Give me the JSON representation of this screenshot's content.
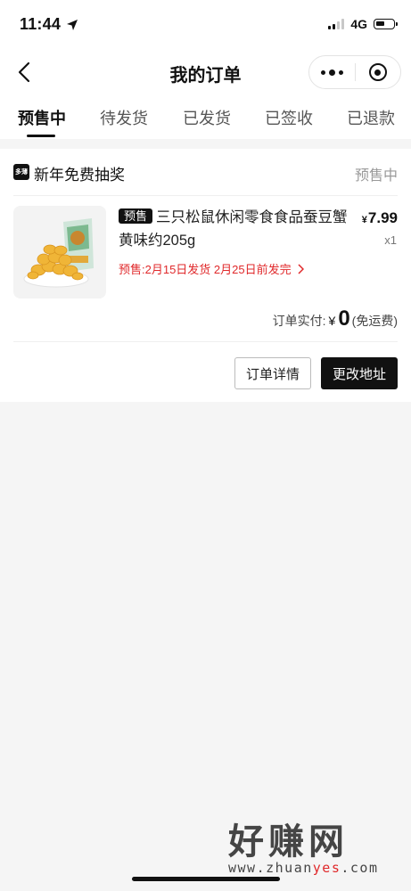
{
  "status_bar": {
    "time": "11:44",
    "network": "4G"
  },
  "nav": {
    "title": "我的订单"
  },
  "tabs": [
    {
      "label": "预售中",
      "active": true
    },
    {
      "label": "待发货"
    },
    {
      "label": "已发货"
    },
    {
      "label": "已签收"
    },
    {
      "label": "已退款"
    }
  ],
  "order": {
    "shop_logo_text": "多薄",
    "shop_name": "新年免费抽奖",
    "status": "预售中",
    "product": {
      "tag": "预售",
      "title": "三只松鼠休闲零食食品蚕豆蟹黄味约205g",
      "price_symbol": "¥",
      "price": "7.99",
      "quantity": "x1",
      "shipping_note": "预售:2月15日发货 2月25日前发完"
    },
    "total": {
      "label": "订单实付:",
      "symbol": "¥",
      "amount": "0",
      "note": "(免运费)"
    },
    "buttons": {
      "detail": "订单详情",
      "change_address": "更改地址"
    }
  },
  "watermark": {
    "text": "好赚网",
    "url_part1": "www.zhuan",
    "url_highlight": "yes",
    "url_part2": ".com"
  }
}
